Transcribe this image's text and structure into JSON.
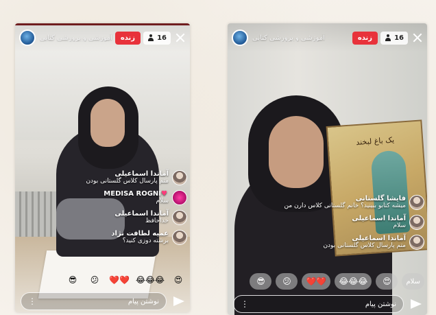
{
  "left": {
    "channel_name": "آموزشی و پرورشی کتابی",
    "live_label": "زنده",
    "viewer_count": "16",
    "comments": [
      {
        "name": "آماندا اسماعیلی",
        "text": "متم پارسال کلاس گلستانی بودن"
      },
      {
        "name": "MEDISA ROGNI",
        "text": "سلام"
      },
      {
        "name": "آماندا اسماعیلی",
        "text": "خداحافظ"
      },
      {
        "name": "عمیه لطافت نژاد",
        "text": "برشته دوزی کنید؟"
      }
    ],
    "emojis": [
      "😎",
      "😕",
      "❤️❤️",
      "😂😂😂",
      "😍"
    ],
    "message_placeholder": "نوشتن پیام"
  },
  "right": {
    "channel_name": "آموزشی و پرورشی کتابی",
    "live_label": "زنده",
    "viewer_count": "16",
    "book_title": "یک باغ لبخند",
    "comments": [
      {
        "name": "فایشا گلستانی",
        "text": "میشه کتابو ببینید؟ خانم گلستانی کلاس دارن من"
      },
      {
        "name": "آماندا اسماعیلی",
        "text": "سلام"
      },
      {
        "name": "آماندا اسماعیلی",
        "text": "متم پارسال کلاس گلستانی بودن"
      }
    ],
    "emojis": [
      "سلام",
      "😍",
      "😂😂😂",
      "❤️❤️",
      "😕",
      "😎"
    ],
    "message_placeholder": "نوشتن پیام"
  }
}
